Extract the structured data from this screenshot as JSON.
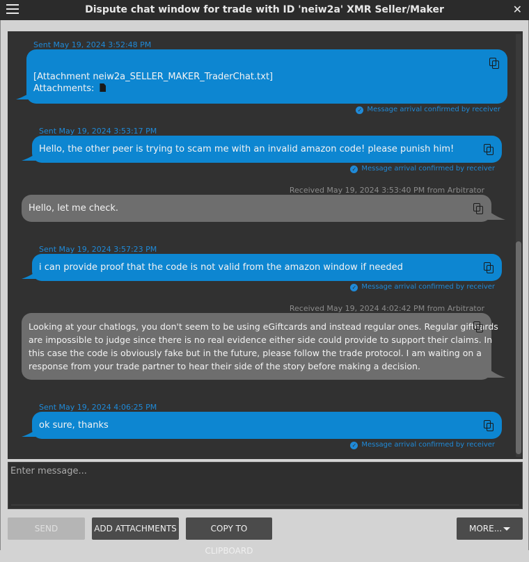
{
  "window": {
    "title": "Dispute chat window for trade with ID 'neiw2a' XMR Seller/Maker"
  },
  "messages": [
    {
      "direction": "sent",
      "meta": "Sent May 19, 2024 3:52:48 PM",
      "line1": "[Attachment neiw2a_SELLER_MAKER_TraderChat.txt]",
      "line2": "Attachments:",
      "confirm": "Message arrival confirmed by receiver"
    },
    {
      "direction": "sent",
      "meta": "Sent May 19, 2024 3:53:17 PM",
      "text": "Hello, the other peer is trying to scam me with an invalid amazon code! please punish him!",
      "confirm": "Message arrival confirmed by receiver"
    },
    {
      "direction": "received",
      "meta": "Received May 19, 2024 3:53:40 PM from Arbitrator",
      "text": "Hello, let me check."
    },
    {
      "direction": "sent",
      "meta": "Sent May 19, 2024 3:57:23 PM",
      "text": "i can provide proof that the code is not valid from the amazon window if needed",
      "confirm": "Message arrival confirmed by receiver"
    },
    {
      "direction": "received",
      "meta": "Received May 19, 2024 4:02:42 PM from Arbitrator",
      "lines": [
        "Looking at your chatlogs, you don't seem to be using eGiftcards and instead regular ones. Regular giftcards",
        "are impossible to judge since there is no real evidence either side could provide to support their claims. In",
        "this case the code is obviously fake but in the future, please follow the trade protocol. I am waiting on a",
        "response from your trade partner to hear their side of the story before making a decision."
      ]
    },
    {
      "direction": "sent",
      "meta": "Sent May 19, 2024 4:06:25 PM",
      "text": "ok sure, thanks",
      "confirm": "Message arrival confirmed by receiver"
    }
  ],
  "input": {
    "placeholder": "Enter message..."
  },
  "buttons": {
    "send": "SEND",
    "add_attachments": "ADD ATTACHMENTS",
    "copy_to_clipboard": "COPY TO CLIPBOARD",
    "more": "MORE..."
  },
  "colors": {
    "sent_bubble": "#0d86d1",
    "received_bubble": "#6e6e6e",
    "chat_background": "#313131",
    "accent": "#1f8ad8"
  }
}
